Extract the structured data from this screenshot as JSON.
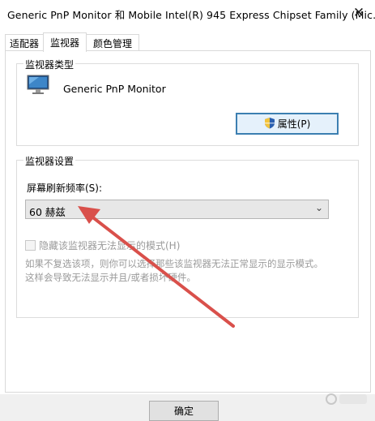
{
  "window": {
    "title": "Generic PnP Monitor 和 Mobile Intel(R) 945 Express Chipset Family (Mic...",
    "close_icon": "✕"
  },
  "tabs": [
    {
      "label": "适配器",
      "active": false
    },
    {
      "label": "监视器",
      "active": true
    },
    {
      "label": "颜色管理",
      "active": false
    }
  ],
  "monitor_type": {
    "group_label": "监视器类型",
    "monitor_name": "Generic PnP Monitor",
    "properties_button": "属性(P)"
  },
  "monitor_settings": {
    "group_label": "监视器设置",
    "refresh_rate_label": "屏幕刷新频率(S):",
    "refresh_rate_value": "60 赫兹",
    "hide_modes_checkbox": "隐藏该监视器无法显示的模式(H)",
    "hide_modes_checked": false,
    "help_text_line1": "如果不复选该项，则你可以选择那些该监视器无法正常显示的显示模式。",
    "help_text_line2": "这样会导致无法显示并且/或者损坏硬件。"
  },
  "footer": {
    "ok_button": "确定"
  },
  "colors": {
    "accent_border": "#3c7fb1",
    "accent_fill": "#e5f1fb",
    "annotation_arrow": "#d9504b"
  }
}
